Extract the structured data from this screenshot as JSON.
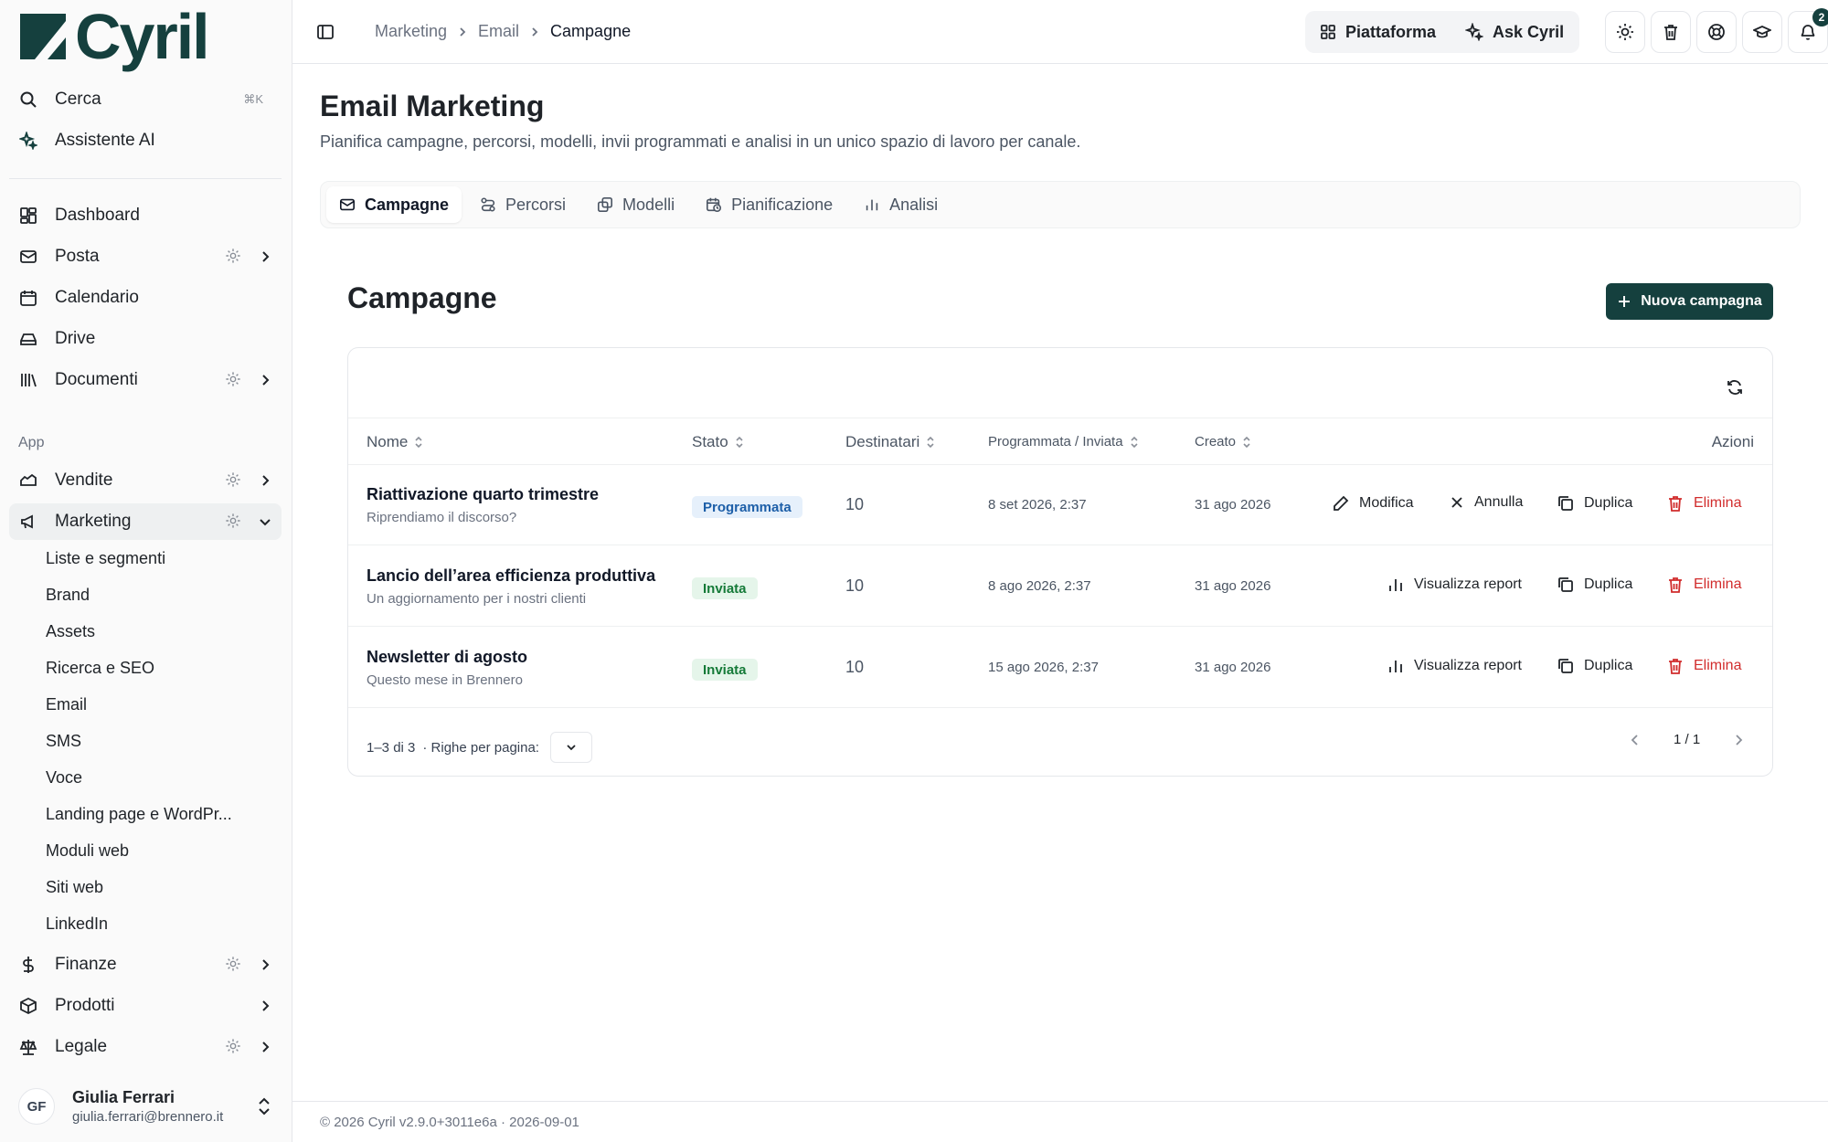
{
  "app": {
    "name": "Cyril"
  },
  "sidebar": {
    "search_label": "Cerca",
    "search_shortcut": "⌘K",
    "assistant_label": "Assistente AI",
    "main_items": [
      {
        "label": "Dashboard",
        "icon": "dashboard-icon"
      },
      {
        "label": "Posta",
        "icon": "mail-icon"
      },
      {
        "label": "Calendario",
        "icon": "calendar-icon"
      },
      {
        "label": "Drive",
        "icon": "drive-icon"
      },
      {
        "label": "Documenti",
        "icon": "library-icon"
      }
    ],
    "section_app": "App",
    "app_items": [
      {
        "label": "Vendite",
        "icon": "sales-icon"
      },
      {
        "label": "Marketing",
        "icon": "megaphone-icon"
      },
      {
        "label": "Finanze",
        "icon": "dollar-icon"
      },
      {
        "label": "Prodotti",
        "icon": "box-icon"
      },
      {
        "label": "Legale",
        "icon": "scale-icon"
      }
    ],
    "marketing_sub": [
      "Liste e segmenti",
      "Brand",
      "Assets",
      "Ricerca e SEO",
      "Email",
      "SMS",
      "Voce",
      "Landing page e WordPr...",
      "Moduli web",
      "Siti web",
      "LinkedIn"
    ],
    "user": {
      "initials": "GF",
      "name": "Giulia Ferrari",
      "email": "giulia.ferrari@brennero.it"
    }
  },
  "topbar": {
    "breadcrumb": [
      "Marketing",
      "Email",
      "Campagne"
    ],
    "platform_label": "Piattaforma",
    "ask_label": "Ask Cyril",
    "notifications_count": "2"
  },
  "page": {
    "title": "Email Marketing",
    "subtitle": "Pianifica campagne, percorsi, modelli, invii programmati e analisi in un unico spazio di lavoro per canale.",
    "tabs": [
      "Campagne",
      "Percorsi",
      "Modelli",
      "Pianificazione",
      "Analisi"
    ],
    "section_title": "Campagne",
    "new_button": "Nuova campagna"
  },
  "table": {
    "headers": [
      "Nome",
      "Stato",
      "Destinatari",
      "Programmata / Inviata",
      "Creato",
      "Azioni"
    ],
    "rows": [
      {
        "name": "Riattivazione quarto trimestre",
        "subject": "Riprendiamo il discorso?",
        "status": "Programmata",
        "recipients": "10",
        "scheduled": "8 set 2026, 2:37",
        "created": "31 ago 2026",
        "actions": [
          "Modifica",
          "Annulla",
          "Duplica",
          "Elimina"
        ]
      },
      {
        "name": "Lancio dell’area efficienza produttiva",
        "subject": "Un aggiornamento per i nostri clienti",
        "status": "Inviata",
        "recipients": "10",
        "scheduled": "8 ago 2026, 2:37",
        "created": "31 ago 2026",
        "actions": [
          "Visualizza report",
          "Duplica",
          "Elimina"
        ]
      },
      {
        "name": "Newsletter di agosto",
        "subject": "Questo mese in Brennero",
        "status": "Inviata",
        "recipients": "10",
        "scheduled": "15 ago 2026, 2:37",
        "created": "31 ago 2026",
        "actions": [
          "Visualizza report",
          "Duplica",
          "Elimina"
        ]
      }
    ],
    "count_text": "1–3 di 3",
    "rows_per_page_label": "· Righe per pagina:",
    "page_indicator": "1 / 1"
  },
  "footer": {
    "text": "© 2026 Cyril v2.9.0+3011e6a · 2026-09-01"
  },
  "colors": {
    "brand": "#15403e",
    "danger": "#d12c2c",
    "scheduled": "#1d5fa8",
    "sent": "#157a38"
  }
}
